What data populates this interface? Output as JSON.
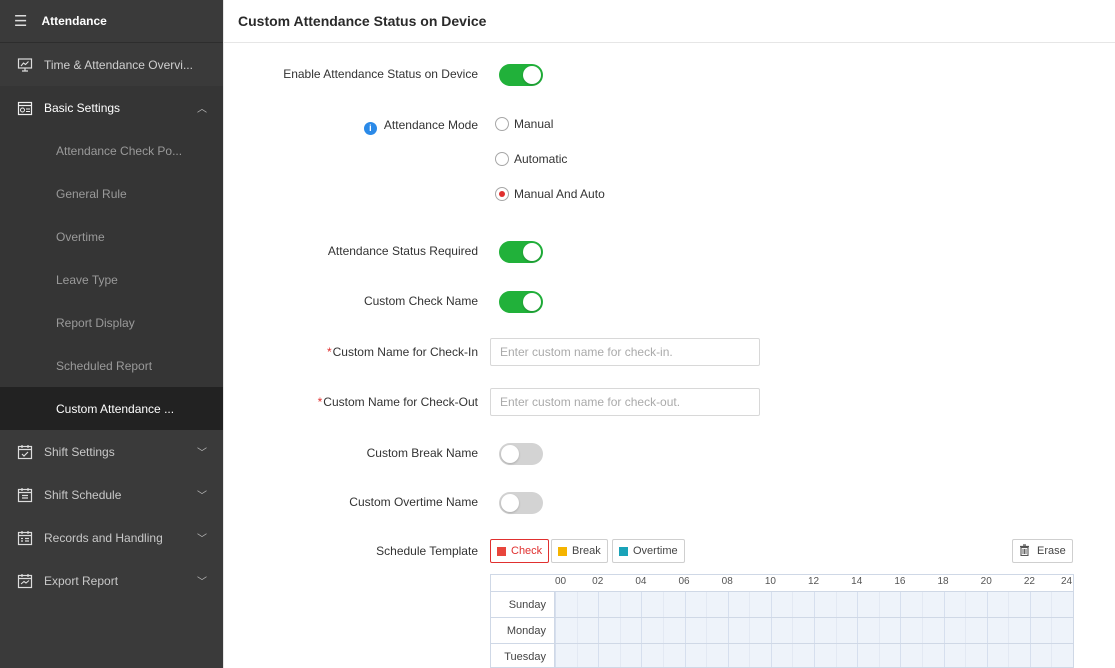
{
  "sidebar": {
    "header": "Attendance",
    "overview": "Time & Attendance Overvi...",
    "basic_settings": "Basic Settings",
    "sub_items": [
      "Attendance Check Po...",
      "General Rule",
      "Overtime",
      "Leave Type",
      "Report Display",
      "Scheduled Report",
      "Custom Attendance ..."
    ],
    "groups": [
      "Shift Settings",
      "Shift Schedule",
      "Records and Handling",
      "Export Report"
    ]
  },
  "page": {
    "title": "Custom Attendance Status on Device"
  },
  "form": {
    "enable_label": "Enable Attendance Status on Device",
    "enable_on": true,
    "mode_label": "Attendance Mode",
    "mode_options": [
      "Manual",
      "Automatic",
      "Manual And Auto"
    ],
    "mode_selected": "Manual And Auto",
    "status_required_label": "Attendance Status Required",
    "status_required_on": true,
    "check_name_label": "Custom Check Name",
    "check_name_on": true,
    "checkin_label": "Custom Name for Check-In",
    "checkin_placeholder": "Enter custom name for check-in.",
    "checkout_label": "Custom Name for Check-Out",
    "checkout_placeholder": "Enter custom name for check-out.",
    "break_label": "Custom Break Name",
    "break_on": false,
    "overtime_label": "Custom Overtime Name",
    "overtime_on": false,
    "required_mark": "*"
  },
  "schedule": {
    "label": "Schedule Template",
    "buttons": [
      {
        "label": "Check",
        "color": "#e8453c"
      },
      {
        "label": "Break",
        "color": "#f5b400"
      },
      {
        "label": "Overtime",
        "color": "#1aa3b8"
      }
    ],
    "erase_label": "Erase",
    "hours": [
      "00",
      "02",
      "04",
      "06",
      "08",
      "10",
      "12",
      "14",
      "16",
      "18",
      "20",
      "22",
      "24"
    ],
    "days": [
      "Sunday",
      "Monday",
      "Tuesday"
    ]
  }
}
